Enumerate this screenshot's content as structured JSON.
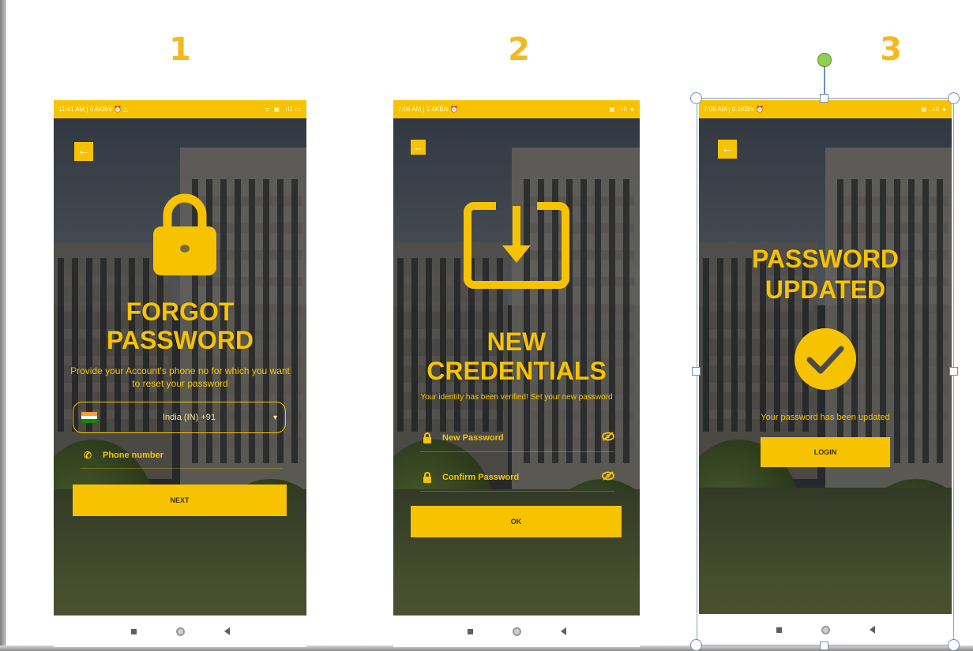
{
  "steps": [
    {
      "number": "1",
      "screen": {
        "status_time": "11:41 AM | 0.6KB/s ⏰ △",
        "status_icons": "ᯤ ▣ .ıll ▭",
        "title_line1": "FORGOT",
        "title_line2": "PASSWORD",
        "subtitle": "Provide your Account's phone no for which you want to reset your password",
        "country_select": "India (IN) +91",
        "phone_placeholder": "Phone number",
        "button": "NEXT"
      }
    },
    {
      "number": "2",
      "screen": {
        "status_time": "7:08 AM | 1.4KB/s ⏰",
        "status_icons": "▣ .ıll ●",
        "title_line1": "NEW",
        "title_line2": "CREDENTIALS",
        "subtitle": "Your identity has been verified! Set your new password",
        "new_password_label": "New Password",
        "confirm_password_label": "Confirm Password",
        "button": "OK"
      }
    },
    {
      "number": "3",
      "screen": {
        "status_time": "7:08 AM | 0.1KB/s ⏰",
        "status_icons": "▣ .ıll ●",
        "title_line1": "PASSWORD",
        "title_line2": "UPDATED",
        "subtitle": "Your password has been updated",
        "button": "LOGIN"
      }
    }
  ],
  "colors": {
    "accent": "#f7c300",
    "step_number": "#f5b822",
    "flag_saffron": "#ff9933",
    "flag_white": "#ffffff",
    "flag_green": "#138808"
  },
  "icons": {
    "screen1_hero": "padlock-icon",
    "screen2_hero": "download-arrow-box-icon",
    "screen3_hero": "checkmark-circle-icon",
    "field_phone": "phone-icon",
    "field_password": "lock-icon",
    "field_visibility": "eye-off-icon"
  }
}
